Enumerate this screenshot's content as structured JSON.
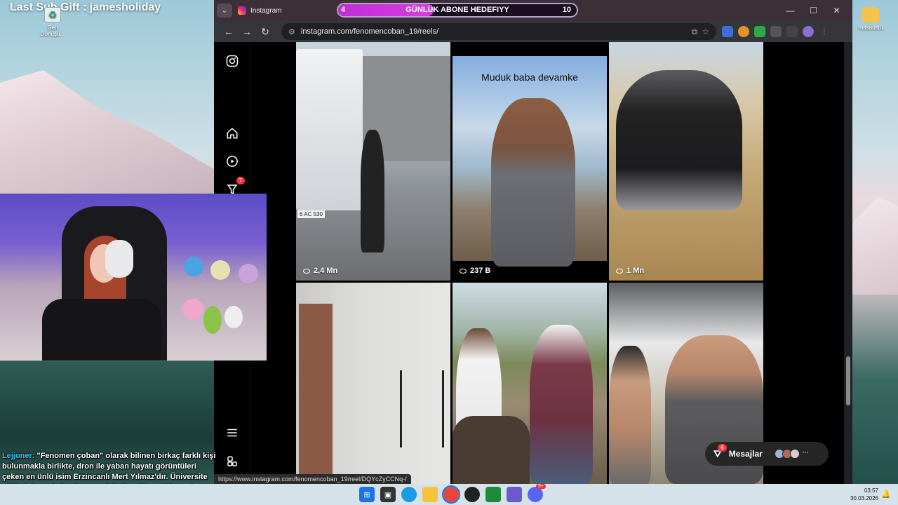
{
  "stream": {
    "title": "Last Sub Gift : jamesholiday",
    "chat_user": "Lejjoner:",
    "chat_message": "\"Fenomen çoban\" olarak bilinen birkaç farklı kişi bulunmakla birlikte, dron ile yaban hayatı görüntüleri çeken en ünlü isim Erzincanlı Mert Yılmaz'dır. Üniversite eğitimini yarıda bırakıp memleketine dönen Yılmaz, koyun otlatırken çektiği kaliteli doğa videolarıyla tanınmaktadır."
  },
  "desktop": {
    "recycle_label": "Geri Dönüşü...",
    "folder_label": "masaüstü"
  },
  "browser": {
    "tab_title": "Instagram",
    "url": "instagram.com/fenomencoban_19/reels/",
    "status_url": "https://www.instagram.com/fenomencoban_19/reel/DQYcZyCCNq-/",
    "controls": {
      "minimize": "—",
      "maximize": "☐",
      "close": "✕"
    }
  },
  "goal": {
    "current": "4",
    "label": "GÜNLÜK ABONE HEDEFIYY",
    "max": "10",
    "progress": 0.4,
    "fill_color": "#c02fd6"
  },
  "instagram": {
    "nav_badge": "7",
    "reels": [
      {
        "views": "2,4 Mn",
        "caption": ""
      },
      {
        "views": "237 B",
        "caption": "Muduk baba devamke"
      },
      {
        "views": "1 Mn",
        "caption": ""
      },
      {
        "views": "",
        "caption": ""
      },
      {
        "views": "",
        "caption": ""
      },
      {
        "views": "",
        "caption": ""
      }
    ],
    "messages": {
      "label": "Mesajlar",
      "badge": "6",
      "more": "···"
    },
    "truck_plate": "6 AC 530"
  },
  "taskbar": {
    "time": "03:57",
    "date": "30.03.2026",
    "discord_badge": "9+"
  }
}
